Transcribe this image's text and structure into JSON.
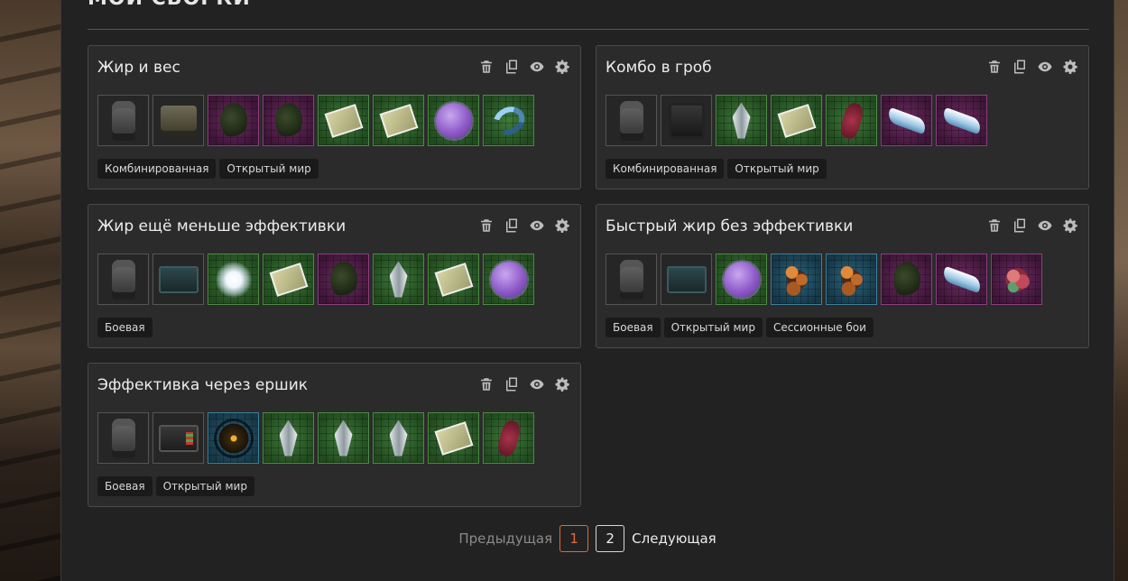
{
  "page": {
    "title": "Мои сборки"
  },
  "cards": [
    {
      "title": "Жир и вес",
      "items": [
        {
          "icon": "armor-icon",
          "rarity": "gray",
          "art": "armor"
        },
        {
          "icon": "backpack-icon",
          "rarity": "gray",
          "art": "pack"
        },
        {
          "icon": "moss-artifact-icon",
          "rarity": "purple",
          "art": "moss"
        },
        {
          "icon": "moss-artifact-icon",
          "rarity": "purple",
          "art": "moss"
        },
        {
          "icon": "map-artifact-icon",
          "rarity": "green",
          "art": "map"
        },
        {
          "icon": "map-artifact-icon",
          "rarity": "green",
          "art": "map"
        },
        {
          "icon": "orb-artifact-icon",
          "rarity": "green",
          "art": "orb"
        },
        {
          "icon": "hook-artifact-icon",
          "rarity": "green",
          "art": "hook"
        }
      ],
      "tags": [
        "Комбинированная",
        "Открытый мир"
      ]
    },
    {
      "title": "Комбо в гроб",
      "items": [
        {
          "icon": "armor-icon",
          "rarity": "gray",
          "art": "armor"
        },
        {
          "icon": "backpack-icon",
          "rarity": "gray",
          "art": "pack-dark"
        },
        {
          "icon": "crystal-artifact-icon",
          "rarity": "green",
          "art": "crystal"
        },
        {
          "icon": "map-artifact-icon",
          "rarity": "green",
          "art": "map"
        },
        {
          "icon": "worm-artifact-icon",
          "rarity": "green",
          "art": "worm"
        },
        {
          "icon": "blade-artifact-icon",
          "rarity": "purple",
          "art": "blade"
        },
        {
          "icon": "blade-artifact-icon",
          "rarity": "purple",
          "art": "blade"
        }
      ],
      "tags": [
        "Комбинированная",
        "Открытый мир"
      ]
    },
    {
      "title": "Жир ещё меньше эффективки",
      "items": [
        {
          "icon": "armor-icon",
          "rarity": "gray",
          "art": "armor"
        },
        {
          "icon": "container-icon",
          "rarity": "gray",
          "art": "container"
        },
        {
          "icon": "glow-artifact-icon",
          "rarity": "green",
          "art": "glow"
        },
        {
          "icon": "map-artifact-icon",
          "rarity": "green",
          "art": "map"
        },
        {
          "icon": "moss-artifact-icon",
          "rarity": "purple",
          "art": "moss"
        },
        {
          "icon": "crystal-artifact-icon",
          "rarity": "green",
          "art": "crystal"
        },
        {
          "icon": "map-artifact-icon",
          "rarity": "green",
          "art": "map"
        },
        {
          "icon": "orb-artifact-icon",
          "rarity": "green",
          "art": "orb"
        }
      ],
      "tags": [
        "Боевая"
      ]
    },
    {
      "title": "Быстрый жир без эффективки",
      "items": [
        {
          "icon": "armor-icon",
          "rarity": "gray",
          "art": "armor"
        },
        {
          "icon": "container-icon",
          "rarity": "gray",
          "art": "container"
        },
        {
          "icon": "orb-artifact-icon",
          "rarity": "green",
          "art": "orb"
        },
        {
          "icon": "rocks-artifact-icon",
          "rarity": "blue",
          "art": "rocks"
        },
        {
          "icon": "rocks-artifact-icon",
          "rarity": "blue",
          "art": "rocks"
        },
        {
          "icon": "moss-artifact-icon",
          "rarity": "purple",
          "art": "moss"
        },
        {
          "icon": "blade-artifact-icon",
          "rarity": "purple",
          "art": "blade"
        },
        {
          "icon": "coral-artifact-icon",
          "rarity": "purple",
          "art": "coral"
        }
      ],
      "tags": [
        "Боевая",
        "Открытый мир",
        "Сессионные бои"
      ]
    },
    {
      "title": "Эффективка через ершик",
      "items": [
        {
          "icon": "armor-icon",
          "rarity": "gray",
          "art": "armor"
        },
        {
          "icon": "container-icon",
          "rarity": "gray",
          "art": "container-red"
        },
        {
          "icon": "spiky-artifact-icon",
          "rarity": "blue",
          "art": "spiky"
        },
        {
          "icon": "crystal-artifact-icon",
          "rarity": "green",
          "art": "crystal"
        },
        {
          "icon": "crystal-artifact-icon",
          "rarity": "green",
          "art": "crystal"
        },
        {
          "icon": "crystal-artifact-icon",
          "rarity": "green",
          "art": "crystal"
        },
        {
          "icon": "map-artifact-icon",
          "rarity": "green",
          "art": "map"
        },
        {
          "icon": "worm-artifact-icon",
          "rarity": "green",
          "art": "worm"
        }
      ],
      "tags": [
        "Боевая",
        "Открытый мир"
      ]
    }
  ],
  "card_actions": [
    {
      "icon": "trash-icon"
    },
    {
      "icon": "copy-icon"
    },
    {
      "icon": "eye-icon"
    },
    {
      "icon": "gear-icon"
    }
  ],
  "pagination": {
    "prev_label": "Предыдущая",
    "pages": [
      "1",
      "2"
    ],
    "current_page": "1",
    "next_label": "Следующая"
  },
  "colors": {
    "panel_bg": "#222222",
    "card_bg": "#2b2b2b",
    "active_page": "#e06a3a",
    "rarity_green": "#3f7a3a",
    "rarity_purple": "#6e2d63",
    "rarity_blue": "#2d6680"
  }
}
